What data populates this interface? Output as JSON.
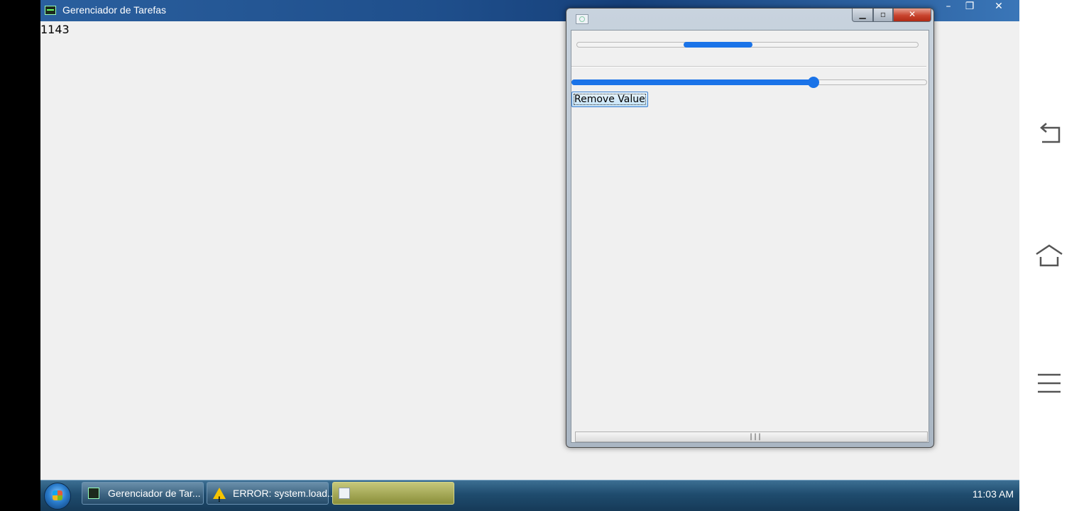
{
  "main_window": {
    "title": "Gerenciador de Tarefas",
    "counter": "1143",
    "controls": {
      "minimize": "–",
      "restore": "❐",
      "close": "✕"
    }
  },
  "dialog": {
    "controls": {
      "minimize": "▁",
      "maximize": "▫",
      "close": "✕"
    },
    "progress_indeterminate": true,
    "slider_value_fraction": 0.68,
    "remove_button_label": "Remove Value",
    "scroll_grip": "|||"
  },
  "taskbar": {
    "items": [
      {
        "label": "Gerenciador de Tar...",
        "icon": "task-manager-icon"
      },
      {
        "label": "ERROR: system.load...",
        "icon": "warning-icon"
      },
      {
        "label": "",
        "icon": "app-window-icon"
      }
    ],
    "clock": "11:03 AM"
  },
  "colors": {
    "accent": "#1a73e8",
    "taskbar": "#1f4c6e",
    "desktop_bg": "#f0f0f0"
  },
  "android_nav": {
    "back": "back-icon",
    "home": "home-icon",
    "menu": "menu-icon"
  }
}
